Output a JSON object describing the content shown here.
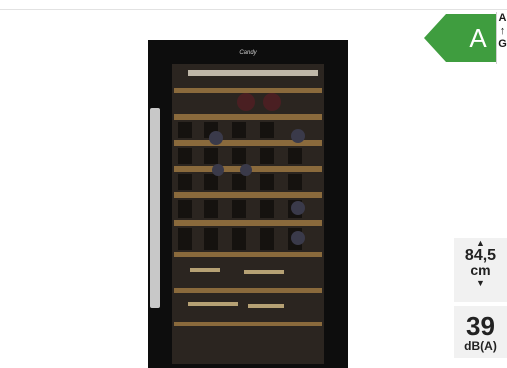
{
  "product": {
    "image_label": "wine-cooler-image",
    "brand_logo": "Candy",
    "colors": {
      "body": "#0d0d0d",
      "shelf": "#8a6a3c",
      "handle": "#c8c8c8"
    }
  },
  "energy": {
    "class": "A",
    "scale_top": "A",
    "scale_arrow": "↑",
    "scale_bottom": "G",
    "color": "#3f9d3f"
  },
  "specs": {
    "height_value": "84,5",
    "height_unit": "cm",
    "noise_value": "39",
    "noise_unit": "dB(A)",
    "up_icon": "caret-up-icon",
    "down_icon": "caret-down-icon"
  }
}
